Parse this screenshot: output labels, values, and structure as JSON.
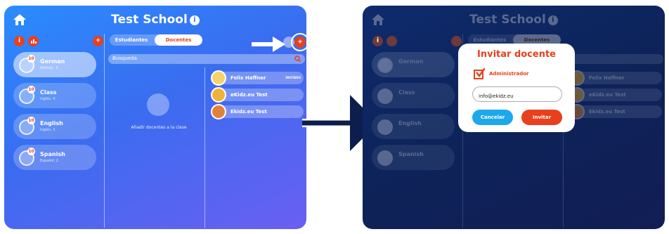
{
  "left": {
    "title": "Test School",
    "info_glyph": "i",
    "tabs": [
      "Estudiantes",
      "Docentes"
    ],
    "search_placeholder": "Búsqueda",
    "classes": [
      {
        "name": "German",
        "sub": "Alemán, 3",
        "badge": "10"
      },
      {
        "name": "Class",
        "sub": "Inglés, 4",
        "badge": "10"
      },
      {
        "name": "English",
        "sub": "Inglés, 3",
        "badge": "10"
      },
      {
        "name": "Spanish",
        "sub": "Español, 2",
        "badge": "10"
      }
    ],
    "empty_text": "Añadir docentes a la clase",
    "teachers": [
      {
        "name": "Felix Haffner",
        "tag": "INVITADO"
      },
      {
        "name": "eKidz.eu Test",
        "tag": ""
      },
      {
        "name": "Ekidz.eu Test",
        "tag": ""
      }
    ],
    "add_glyph": "+"
  },
  "dialog": {
    "title": "Invitar docente",
    "checkbox_label": "Administrador",
    "email_value": "info@ekidz.eu",
    "cancel": "Cancelar",
    "invite": "Invitar"
  },
  "colors": {
    "accent": "#e8401c",
    "blue": "#2a8cff",
    "dark": "#0d2359",
    "cancel": "#1da8ec"
  }
}
